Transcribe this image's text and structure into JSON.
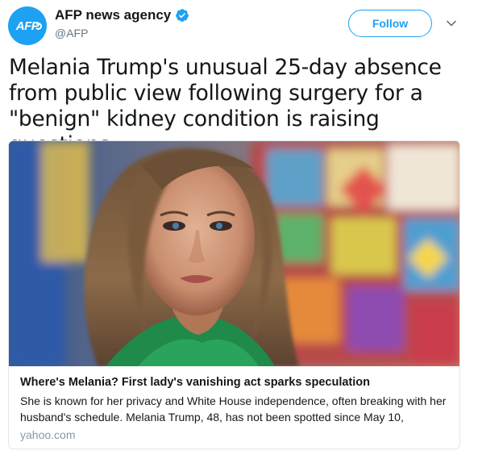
{
  "account": {
    "display_name": "AFP news agency",
    "handle": "@AFP",
    "avatar_text": "AFP",
    "verified": true
  },
  "actions": {
    "follow_label": "Follow"
  },
  "tweet": {
    "text": "Melania Trump's unusual 25-day absence from public view following surgery for a \"benign\" kidney condition is raising questions"
  },
  "card": {
    "title": "Where's Melania? First lady's vanishing act sparks speculation",
    "description": "She is known for her privacy and White House independence, often breaking with her husband's schedule. Melania Trump, 48, has not been spotted since May 10,",
    "domain": "yahoo.com"
  },
  "colors": {
    "accent": "#1da1f2",
    "text": "#14171a",
    "muted": "#657786",
    "border": "#e1e8ed"
  },
  "icons": {
    "verified": "verified-badge-icon",
    "more": "chevron-down-icon"
  }
}
